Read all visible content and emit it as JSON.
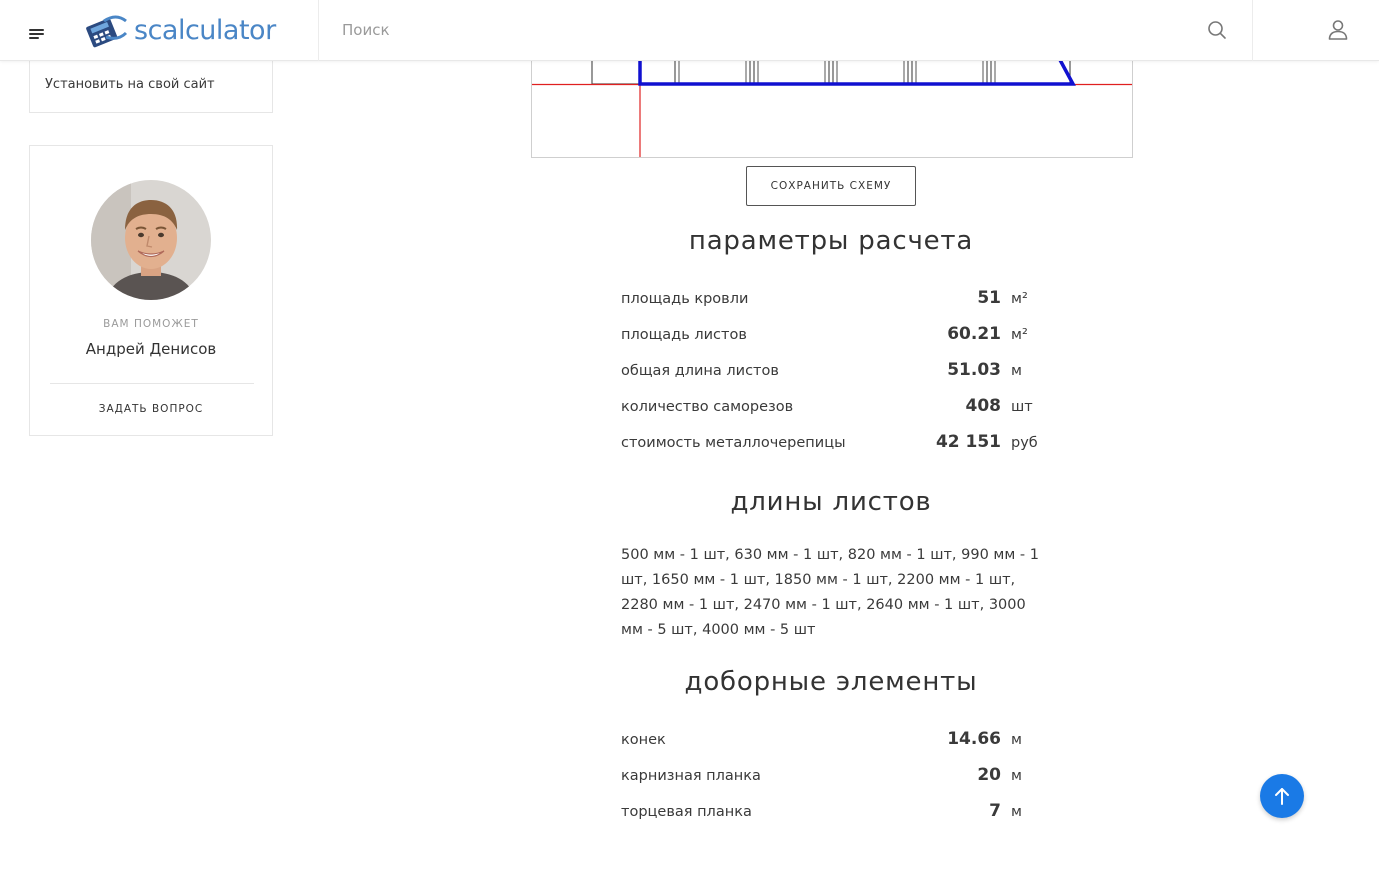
{
  "header": {
    "logo_text": "scalculator",
    "search_placeholder": "Поиск"
  },
  "sidebar": {
    "install_link": "Установить на свой сайт",
    "helper": {
      "label": "ВАМ ПОМОЖЕТ",
      "name": "Андрей Денисов",
      "ask_button": "ЗАДАТЬ ВОПРОС"
    }
  },
  "scheme": {
    "save_button": "СОХРАНИТЬ СХЕМУ",
    "colors": {
      "outline": "#1010d0",
      "guides": "#e02020",
      "sheets": "#555555"
    }
  },
  "params": {
    "title": "параметры расчета",
    "rows": [
      {
        "label": "площадь кровли",
        "value": "51",
        "unit": "м²"
      },
      {
        "label": "площадь листов",
        "value": "60.21",
        "unit": "м²"
      },
      {
        "label": "общая длина листов",
        "value": "51.03",
        "unit": "м"
      },
      {
        "label": "количество саморезов",
        "value": "408",
        "unit": "шт"
      },
      {
        "label": "стоимость металлочерепицы",
        "value": "42 151",
        "unit": "руб"
      }
    ]
  },
  "lengths": {
    "title": "длины листов",
    "text": "500 мм - 1 шт, 630 мм - 1 шт, 820 мм - 1 шт, 990 мм - 1 шт, 1650 мм - 1 шт, 1850 мм - 1 шт, 2200 мм - 1 шт, 2280 мм - 1 шт, 2470 мм - 1 шт, 2640 мм - 1 шт, 3000 мм - 5 шт, 4000 мм - 5 шт"
  },
  "extras": {
    "title": "доборные элементы",
    "rows": [
      {
        "label": "конек",
        "value": "14.66",
        "unit": "м"
      },
      {
        "label": "карнизная планка",
        "value": "20",
        "unit": "м"
      },
      {
        "label": "торцевая планка",
        "value": "7",
        "unit": "м"
      }
    ]
  },
  "accent_color": "#1a7ae6",
  "icons": [
    "menu-icon",
    "logo-icon",
    "search-icon",
    "user-icon",
    "arrow-up-icon"
  ]
}
